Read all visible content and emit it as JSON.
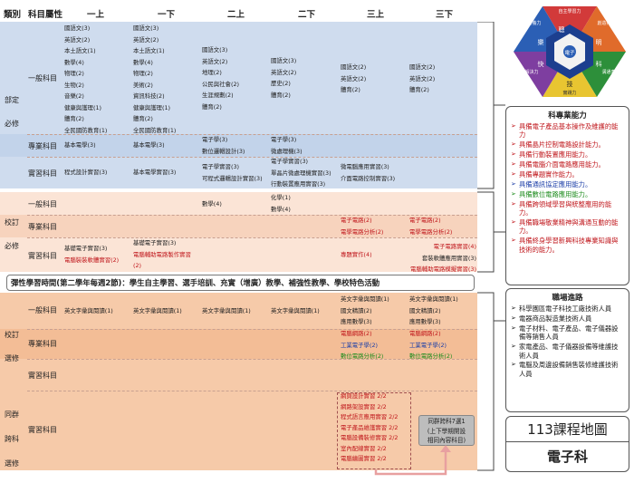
{
  "header": {
    "type": "類別",
    "attr": "科目屬性",
    "sem": [
      "一上",
      "一下",
      "二上",
      "二下",
      "三上",
      "三下"
    ]
  },
  "groups": {
    "required": "部定\n必修",
    "school_required": "校訂\n必修",
    "school_elective": "校訂\n選修",
    "cross_elective": "同群\n跨科\n選修"
  },
  "rows": {
    "general": "一般科目",
    "professional": "專業科目",
    "practice": "實習科目",
    "s_general": "一般科目",
    "s_professional": "專業科目",
    "s_practice": "實習科目",
    "e_general": "一般科目",
    "e_professional": "專業科目",
    "e_practice": "實習科目",
    "c_practice": "實習科目"
  },
  "cells": {
    "req_gen_1a": [
      "國語文(3)",
      "英語文(2)",
      "本土語文(1)",
      "數學(4)",
      "物理(2)",
      "生物(2)",
      "音樂(2)",
      "健康與護理(1)",
      "體育(2)",
      "全民國防教育(1)"
    ],
    "req_gen_1b": [
      "國語文(3)",
      "英語文(2)",
      "本土語文(1)",
      "數學(4)",
      "物理(2)",
      "美術(2)",
      "資訊科技(2)",
      "健康與護理(1)",
      "體育(2)",
      "全民國防教育(1)"
    ],
    "req_gen_2a": [
      "國語文(3)",
      "英語文(2)",
      "地理(2)",
      "公民與社會(2)",
      "生涯規劃(2)",
      "體育(2)"
    ],
    "req_gen_2b": [
      "國語文(3)",
      "英語文(2)",
      "歷史(2)",
      "體育(2)"
    ],
    "req_gen_3a": [
      "國語文(2)",
      "英語文(2)",
      "體育(2)"
    ],
    "req_gen_3b": [
      "國語文(2)",
      "英語文(2)",
      "體育(2)"
    ],
    "req_pro_1a": [
      "基本電學(3)"
    ],
    "req_pro_1b": [
      "基本電學(3)"
    ],
    "req_pro_2a": [
      "電子學(3)",
      "數位邏輯設計(3)"
    ],
    "req_pro_2b": [
      "電子學(3)",
      "微處理機(3)"
    ],
    "req_pra_1a": [
      "程式設計實習(3)"
    ],
    "req_pra_1b": [
      "基本電學實習(3)"
    ],
    "req_pra_2a": [
      "電子學實習(3)",
      "可程式邏輯設計實習(3)"
    ],
    "req_pra_2b": [
      "電子學實習(3)",
      "單晶片微處理機實習(3)",
      "行動裝置應用實習(3)"
    ],
    "req_pra_3a": [
      "微電腦應用實習(3)",
      "介面電路控制實習(3)"
    ],
    "s_gen_2a": [
      "數學(4)"
    ],
    "s_gen_2b": [
      "化學(1)",
      "數學(4)"
    ],
    "s_pro_3a": [
      "電子電路(2)",
      "電學電路分析(2)"
    ],
    "s_pro_3b": [
      "電子電路(2)",
      "電學電路分析(2)"
    ],
    "s_pra_1a": [
      "基礎電子實習(3)",
      "電腦裝裝軟體實習(2)"
    ],
    "s_pra_1b": [
      "基礎電子實習(3)",
      "電腦輔助電路製作實習",
      "(2)"
    ],
    "s_pra_3a": [
      "專題實作(4)"
    ],
    "s_pra_3b": [
      "電子電路實習(4)",
      "套裝軟體應用實習(3)",
      "電腦輔助電路模擬實習(3)"
    ],
    "flex": "彈性學習時間(第二學年每週2節)：學生自主學習、選手培訓、充實（增廣）教學、補強性教學、學校特色活動",
    "e_gen_1a": [
      "英文字彙與閱讀(1)"
    ],
    "e_gen_1b": [
      "英文字彙與閱讀(1)"
    ],
    "e_gen_2a": [
      "英文字彙與閱讀(1)"
    ],
    "e_gen_2b": [
      "英文字彙與閱讀(1)"
    ],
    "e_gen_3a": [
      "英文字彙與閱讀(1)",
      "國文精讀(2)",
      "應用數學(3)"
    ],
    "e_gen_3b": [
      "英文字彙與閱讀(1)",
      "國文精讀(2)",
      "應用數學(3)"
    ],
    "e_pro_3a": [
      "電腦網路(2)",
      "工業電子學(2)",
      "數位電路分析(2)"
    ],
    "e_pro_3b": [
      "電腦網路(2)",
      "工業電子學(2)",
      "數位電路分析(2)"
    ],
    "c_pra_3a": [
      "網頁設計實習 2/2",
      "網路架設實習 2/2",
      "程式語言應用實習 2/2",
      "電子產品維護實習 2/2",
      "電腦設備裝修實習 2/2",
      "室內配線實習 2/2",
      "電腦繪圖實習 2/2"
    ],
    "note": "同群跨科7選1\n(上下學期開設\n相同內容科目)"
  },
  "hex": {
    "center": "電子",
    "labels": [
      "自主學習力",
      "創造行動力",
      "溝通表達力",
      "實踐力",
      "問題解決力",
      "國際素養力"
    ],
    "segs": [
      "聰",
      "明",
      "科",
      "技",
      "快",
      "樂"
    ]
  },
  "ability": {
    "title": "科專業能力",
    "items": [
      "具備電子產品基本操作及維護的能力",
      "具備晶片控制電路設計能力。",
      "具備行動裝置應用能力。",
      "具備電腦介面電路應用能力。",
      "具備專題實作能力。",
      "具備通訊協定應用能力。",
      "具備數位電路應用能力。",
      "具備跨領域學習與統整應用的能力。",
      "具備職場敬業精神與溝通互動的能力。",
      "具備終身學習新興科技專業知識與技術的能力。"
    ]
  },
  "career": {
    "title": "職場進路",
    "items": [
      "科學園區電子科技工廠技術人員",
      "電器商品製造業技術人員",
      "電子材料、電子產品、電子儀器設備等銷售人員",
      "家電產品、電子儀器設備等維護技術人員",
      "電腦及周邊設備銷售裝修維護技術人員"
    ]
  },
  "map": {
    "title": "113課程地圖",
    "dept": "電子科"
  },
  "colors": {
    "blue": "#cfdcee",
    "pink": "#fbe4d6",
    "orange": "#f6caa9",
    "red": "#c0171c"
  }
}
